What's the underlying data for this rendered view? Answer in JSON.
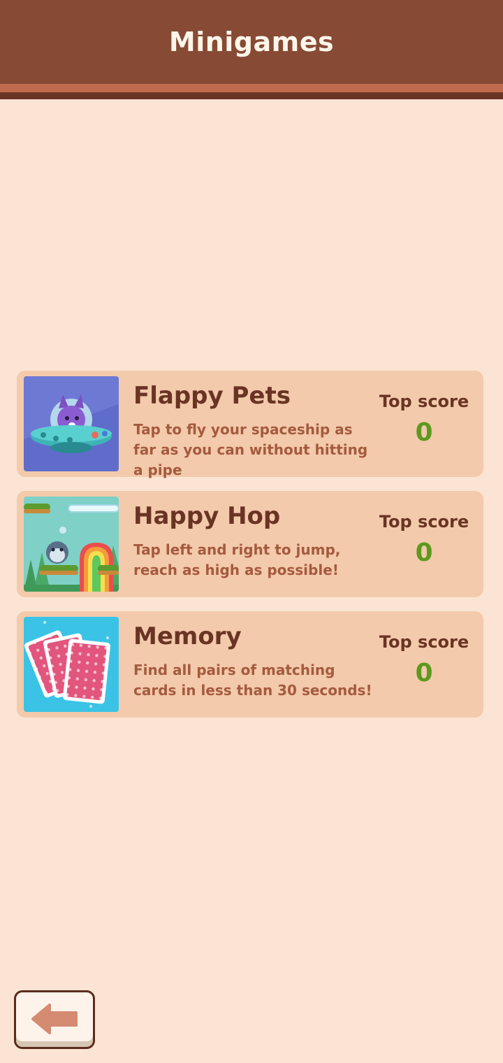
{
  "header": {
    "title": "Minigames"
  },
  "games": [
    {
      "name": "Flappy Pets",
      "description": "Tap to fly your spaceship as far as you can without hitting a pipe",
      "score_label": "Top score",
      "score": "0",
      "thumbnail_icon": "ufo-pet-icon"
    },
    {
      "name": "Happy Hop",
      "description": "Tap left and right to jump, reach as high as possible!",
      "score_label": "Top score",
      "score": "0",
      "thumbnail_icon": "rainbow-jump-icon"
    },
    {
      "name": "Memory",
      "description": "Find all pairs of matching cards in less than 30 seconds!",
      "score_label": "Top score",
      "score": "0",
      "thumbnail_icon": "cards-icon"
    }
  ],
  "back_button": {
    "icon": "back-arrow-icon"
  },
  "colors": {
    "background": "#fbe4d4",
    "header": "#874a35",
    "card": "#f3caab",
    "title_text": "#6a3424",
    "description_text": "#a55a3f",
    "score_value": "#5c9a1f"
  }
}
